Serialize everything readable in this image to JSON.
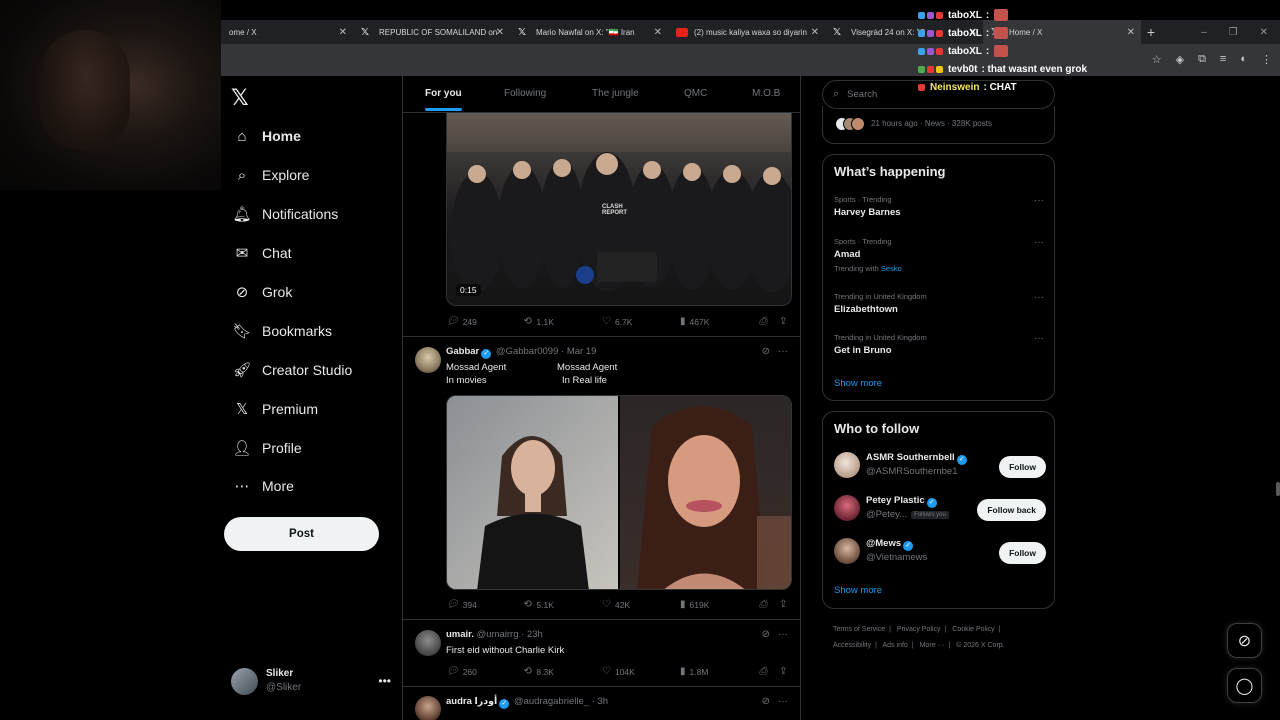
{
  "browser": {
    "tabs": [
      {
        "title": "ome / X",
        "icon": "none",
        "active": false
      },
      {
        "title": "REPUBLIC OF SOMALILAND on",
        "icon": "x-logo",
        "active": false
      },
      {
        "title": "Mario Nawfal on X: \"🇮🇷 Iran",
        "icon": "x-logo",
        "active": false
      },
      {
        "title": "(2) music kaliya waxa so diyarin",
        "icon": "youtube-logo",
        "active": false
      },
      {
        "title": "Visegrád 24 on X: \"C",
        "icon": "x-logo",
        "active": false
      },
      {
        "title": "Home / X",
        "icon": "x-logo",
        "active": true
      }
    ],
    "new_tab": "+",
    "window_controls": [
      "–",
      "❐",
      "✕"
    ]
  },
  "chat": [
    {
      "user": "taboXL",
      "message": ":",
      "user_color": "#ffffff"
    },
    {
      "user": "taboXL",
      "message": ":",
      "user_color": "#ffffff"
    },
    {
      "user": "taboXL",
      "message": ":",
      "user_color": "#ffffff"
    },
    {
      "user": "tevb0t",
      "message": ": that wasnt even grok",
      "user_color": "#ffffff"
    },
    {
      "user": "Neinswein",
      "message": ": CHAT",
      "user_color": "#f7e75a"
    }
  ],
  "nav": {
    "items": [
      {
        "label": "Home",
        "icon": "home-icon",
        "glyph": "⌂",
        "bold": true
      },
      {
        "label": "Explore",
        "icon": "search-icon",
        "glyph": "⌕",
        "bold": false
      },
      {
        "label": "Notifications",
        "icon": "bell-icon",
        "glyph": "🔔︎",
        "bold": false
      },
      {
        "label": "Chat",
        "icon": "mail-icon",
        "glyph": "✉",
        "bold": false
      },
      {
        "label": "Grok",
        "icon": "grok-icon",
        "glyph": "⊘",
        "bold": false
      },
      {
        "label": "Bookmarks",
        "icon": "bookmark-icon",
        "glyph": "🔖︎",
        "bold": false
      },
      {
        "label": "Creator Studio",
        "icon": "rocket-icon",
        "glyph": "🚀︎",
        "bold": false
      },
      {
        "label": "Premium",
        "icon": "x-premium-icon",
        "glyph": "𝕏",
        "bold": false
      },
      {
        "label": "Profile",
        "icon": "person-icon",
        "glyph": "👤︎",
        "bold": false
      },
      {
        "label": "More",
        "icon": "more-circle-icon",
        "glyph": "⋯",
        "bold": false
      }
    ],
    "post_label": "Post",
    "account": {
      "display_name": "Sliker",
      "handle": "@Sliker"
    }
  },
  "timeline": {
    "tabs": [
      "For you",
      "Following",
      "The jungle",
      "QMC",
      "M.O.B"
    ],
    "selected_tab": "For you",
    "posts": [
      {
        "video_time": "0:15",
        "video_watermark": "CLASH REPORT",
        "stats": {
          "replies": "249",
          "reposts": "1.1K",
          "likes": "6.7K",
          "views": "467K"
        }
      },
      {
        "display_name": "Gabbar",
        "handle": "@Gabbar0099",
        "date": "· Mar 19",
        "text_left": [
          "Mossad Agent",
          "In movies"
        ],
        "text_right": [
          "Mossad Agent",
          "In Real life"
        ],
        "stats": {
          "replies": "394",
          "reposts": "5.1K",
          "likes": "42K",
          "views": "619K"
        }
      },
      {
        "display_name": "umair.",
        "handle": "@umairrg",
        "date": "· 23h",
        "text": "First eid without Charlie Kirk",
        "stats": {
          "replies": "260",
          "reposts": "8.3K",
          "likes": "104K",
          "views": "1.8M"
        }
      },
      {
        "display_name": "audra أودرا",
        "handle": "@audragabrielle_",
        "date": "· 3h"
      }
    ]
  },
  "sidebar": {
    "search_placeholder": "Search",
    "news_meta": "21 hours ago · News · 328K posts",
    "whats_happening": {
      "title": "What’s happening",
      "trends": [
        {
          "context": "Sports · Trending",
          "name": "Harvey Barnes",
          "sub": ""
        },
        {
          "context": "Sports · Trending",
          "name": "Amad",
          "sub_prefix": "Trending with",
          "sub_link": "Sesko"
        },
        {
          "context": "Trending in United Kingdom",
          "name": "Elizabethtown",
          "sub": ""
        },
        {
          "context": "Trending in United Kingdom",
          "name": "Get in Bruno",
          "sub": ""
        }
      ],
      "show_more": "Show more"
    },
    "who_to_follow": {
      "title": "Who to follow",
      "accounts": [
        {
          "name": "ASMR Southernbell",
          "handle": "@ASMRSouthernbe1",
          "button": "Follow",
          "verified": true,
          "follows_you": ""
        },
        {
          "name": "Petey Plastic",
          "handle": "@Petey...",
          "button": "Follow back",
          "verified": true,
          "follows_you": "Follows you"
        },
        {
          "name": "@Mews",
          "handle": "@Vietnamews",
          "button": "Follow",
          "verified": true,
          "follows_you": ""
        }
      ],
      "show_more": "Show more"
    },
    "footer": {
      "line1": [
        "Terms of Service",
        "|",
        "Privacy Policy",
        "|",
        "Cookie Policy",
        "|"
      ],
      "line2": [
        "Accessibility",
        "|",
        "Ads info",
        "|",
        "More ···",
        "|",
        "© 2026 X Corp."
      ]
    }
  },
  "colors": {
    "accent": "#1d9bf0",
    "border": "#2f3336",
    "muted": "#71767b",
    "text": "#e7e9ea"
  }
}
